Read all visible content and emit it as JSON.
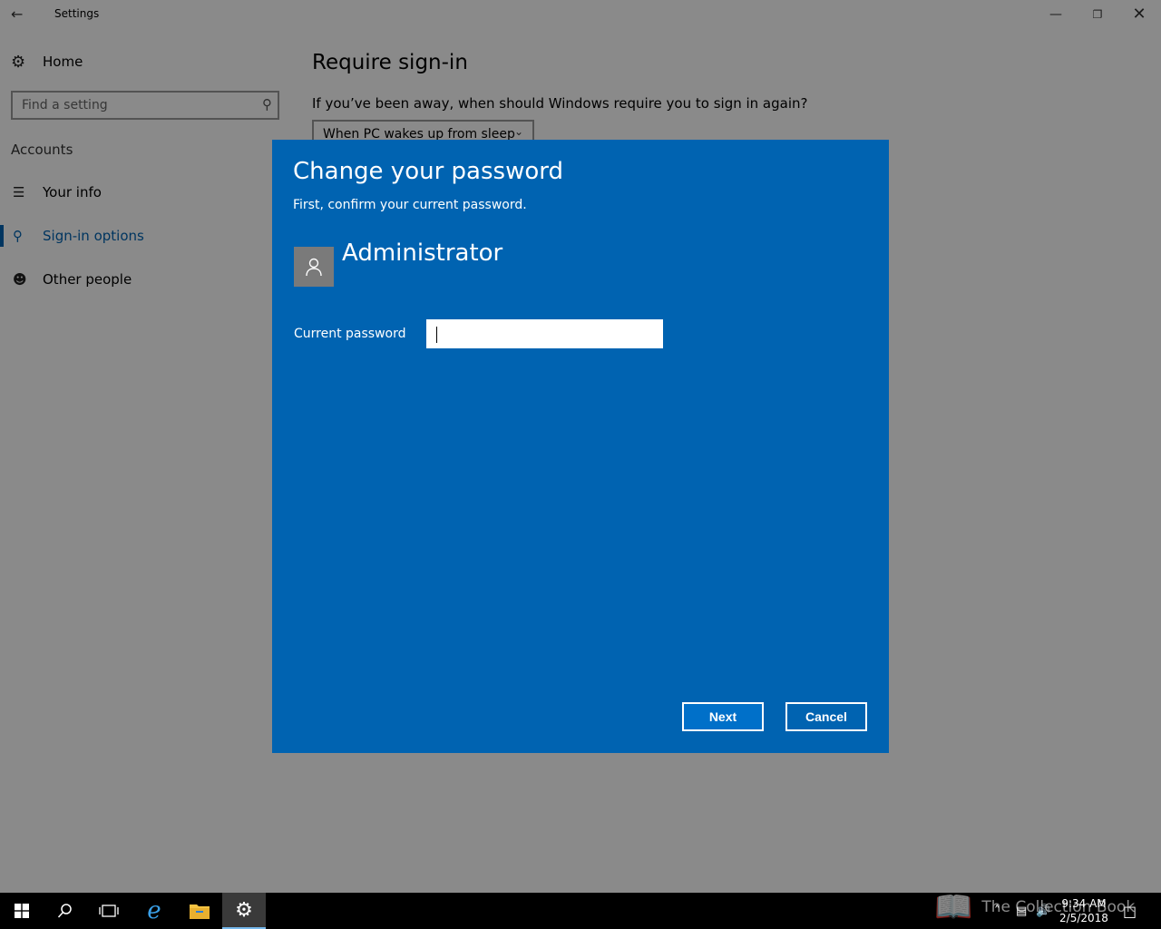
{
  "window": {
    "title": "Settings",
    "back_icon": "back-arrow-icon",
    "minimize_glyph": "—",
    "maximize_glyph": "❐",
    "close_glyph": "✕"
  },
  "sidebar": {
    "home_label": "Home",
    "search_placeholder": "Find a setting",
    "section_label": "Accounts",
    "items": [
      {
        "label": "Your info",
        "icon": "contact-card-icon",
        "active": false
      },
      {
        "label": "Sign-in options",
        "icon": "key-icon",
        "active": true
      },
      {
        "label": "Other people",
        "icon": "person-add-icon",
        "active": false
      }
    ]
  },
  "content": {
    "title": "Require sign-in",
    "description": "If you’ve been away, when should Windows require you to sign in again?",
    "select_value": "When PC wakes up from sleep"
  },
  "dialog": {
    "title": "Change your password",
    "subtitle": "First, confirm your current password.",
    "username": "Administrator",
    "password_label": "Current password",
    "password_value": "",
    "next_label": "Next",
    "cancel_label": "Cancel",
    "background_color": "#0063b1"
  },
  "taskbar": {
    "items": [
      "windows-start-icon",
      "search-icon",
      "task-view-icon",
      "internet-explorer-icon",
      "file-explorer-icon",
      "settings-gear-icon"
    ],
    "active_item": "settings-gear-icon",
    "time": "9:34 AM",
    "date": "2/5/2018"
  },
  "watermark": {
    "text": "The Collection Book"
  }
}
